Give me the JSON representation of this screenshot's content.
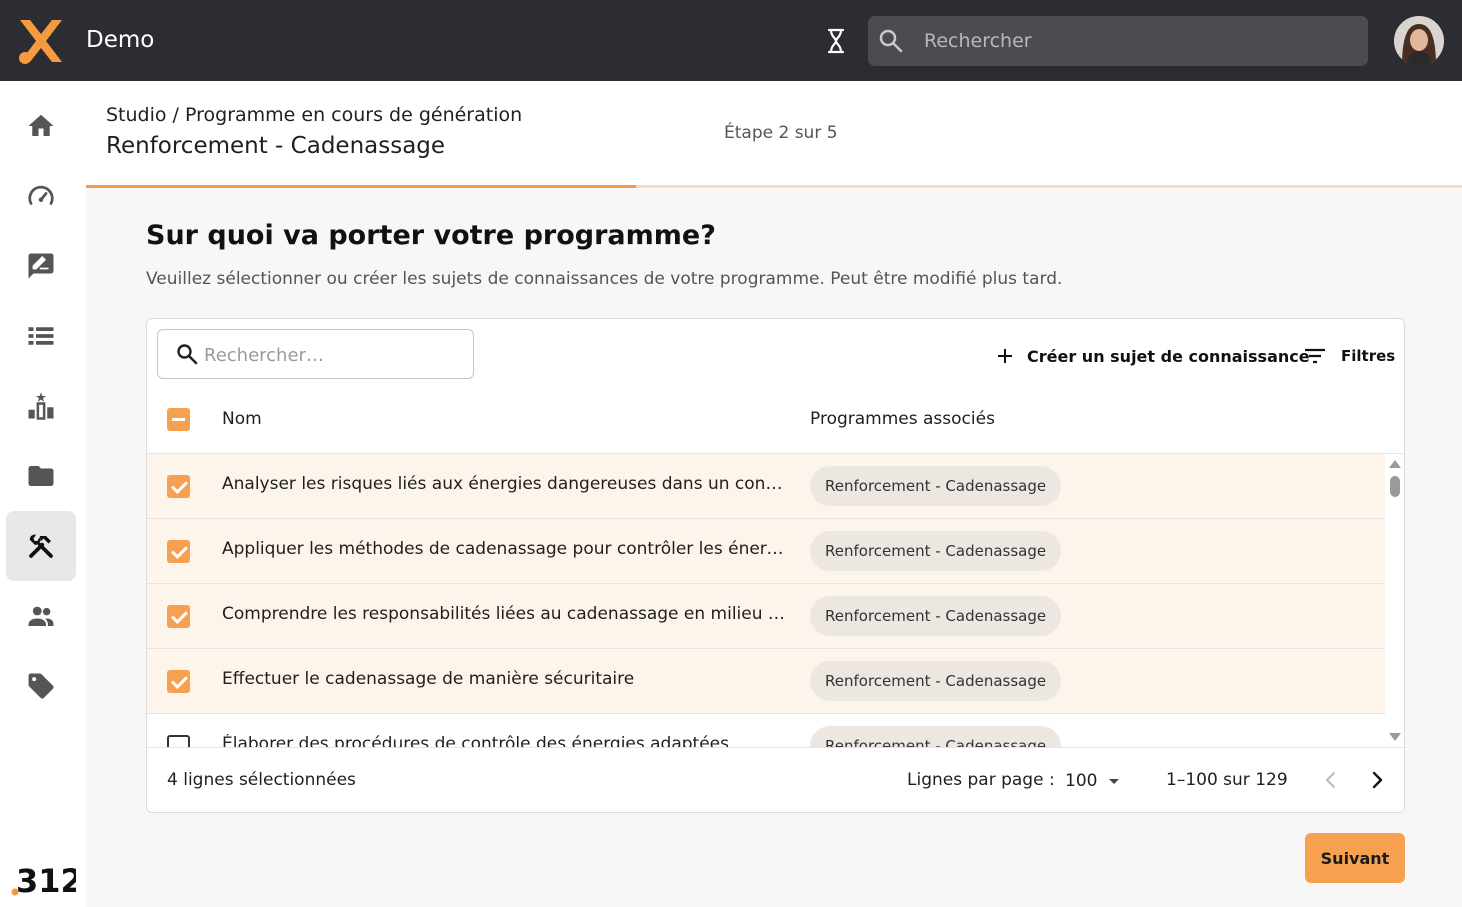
{
  "app": {
    "title": "Demo"
  },
  "search": {
    "placeholder": "Rechercher"
  },
  "header": {
    "breadcrumb": "Studio / Programme en cours de génération",
    "title": "Renforcement - Cadenassage",
    "step": "Étape 2 sur 5",
    "progress": 0.4
  },
  "main": {
    "heading": "Sur quoi va porter votre programme?",
    "description": "Veuillez sélectionner ou créer les sujets de connaissances de votre programme. Peut être modifié plus tard."
  },
  "table": {
    "search_placeholder": "Rechercher…",
    "create_label": "Créer un sujet de connaissance",
    "filters_label": "Filtres",
    "columns": {
      "name": "Nom",
      "programs": "Programmes associés"
    },
    "rows": [
      {
        "name": "Analyser les risques liés aux énergies dangereuses dans un contexte…",
        "program": "Renforcement - Cadenassage",
        "selected": true
      },
      {
        "name": "Appliquer les méthodes de cadenassage pour contrôler les énergies",
        "program": "Renforcement - Cadenassage",
        "selected": true
      },
      {
        "name": "Comprendre les responsabilités liées au cadenassage en milieu de t…",
        "program": "Renforcement - Cadenassage",
        "selected": true
      },
      {
        "name": "Effectuer le cadenassage de manière sécuritaire",
        "program": "Renforcement - Cadenassage",
        "selected": true
      },
      {
        "name": "Élaborer des procédures de contrôle des énergies adaptées",
        "program": "Renforcement - Cadenassage",
        "selected": false
      }
    ],
    "footer": {
      "selected_count": "4 lignes sélectionnées",
      "rows_per_page_label": "Lignes par page :",
      "rows_per_page_value": "100",
      "range": "1–100 sur 129"
    }
  },
  "actions": {
    "next_label": "Suivant"
  },
  "brand": {
    "footer_logo": "312"
  },
  "colors": {
    "accent": "#f7a04f",
    "topbar": "#2b2d33",
    "logo_orange": "#f59a3e"
  },
  "sidebar": {
    "items": [
      {
        "icon": "home-icon"
      },
      {
        "icon": "dashboard-icon"
      },
      {
        "icon": "feedback-icon"
      },
      {
        "icon": "list-icon"
      },
      {
        "icon": "leaderboard-icon"
      },
      {
        "icon": "folder-icon"
      },
      {
        "icon": "tools-icon",
        "active": true
      },
      {
        "icon": "group-icon"
      },
      {
        "icon": "tag-icon"
      }
    ]
  }
}
